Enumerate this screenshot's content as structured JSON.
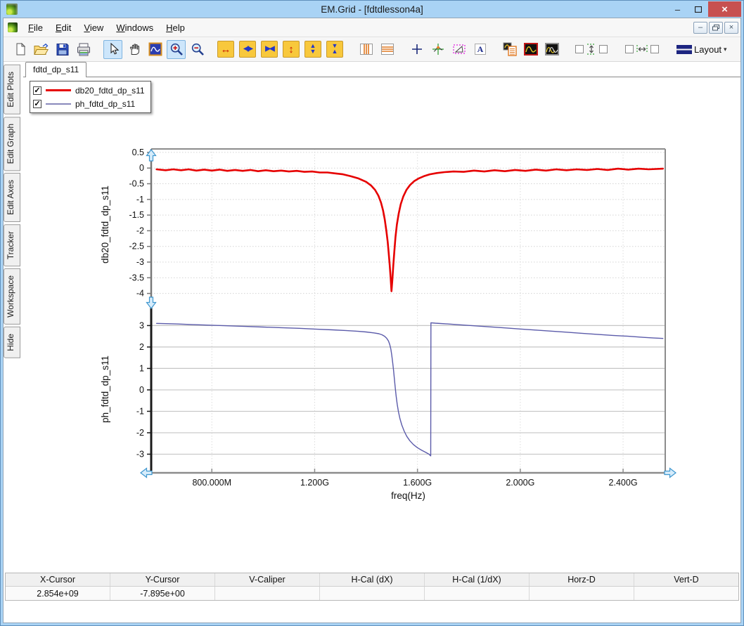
{
  "window": {
    "title": "EM.Grid - [fdtdlesson4a]"
  },
  "titlebar_icons": [
    "app-icon",
    "minimize-icon",
    "maximize-icon",
    "close-icon"
  ],
  "menu": {
    "items": [
      "File",
      "Edit",
      "View",
      "Windows",
      "Help"
    ]
  },
  "mdi_icons": [
    "mdi-minimize-icon",
    "mdi-restore-icon",
    "mdi-close-icon"
  ],
  "toolbar": {
    "layout_label": "Layout",
    "groups": [
      [
        {
          "name": "new-document"
        },
        {
          "name": "open-file"
        },
        {
          "name": "save-file"
        },
        {
          "name": "print"
        }
      ],
      [
        {
          "name": "select-pointer",
          "active": true
        },
        {
          "name": "pan-hand"
        },
        {
          "name": "zoom-window"
        },
        {
          "name": "zoom-in",
          "active": true
        },
        {
          "name": "zoom-out"
        }
      ],
      [
        {
          "name": "expand-x",
          "style": "yellow"
        },
        {
          "name": "shrink-x",
          "style": "yellow"
        },
        {
          "name": "compress-x",
          "style": "yellow"
        },
        {
          "name": "expand-y",
          "style": "yellow"
        },
        {
          "name": "shrink-y",
          "style": "yellow"
        },
        {
          "name": "compress-y",
          "style": "yellow"
        }
      ],
      [
        {
          "name": "vertical-markers"
        },
        {
          "name": "horizontal-markers"
        }
      ],
      [
        {
          "name": "crosshair"
        },
        {
          "name": "tracker"
        },
        {
          "name": "caliper"
        },
        {
          "name": "text-label"
        }
      ],
      [
        {
          "name": "copy-plot"
        },
        {
          "name": "trace-single"
        },
        {
          "name": "trace-overlay"
        }
      ],
      [
        {
          "name": "v-caliper-toggles",
          "wide": true
        }
      ],
      [
        {
          "name": "h-caliper-toggles",
          "wide": true
        }
      ],
      [
        {
          "name": "layout-menu",
          "wide": true
        }
      ]
    ]
  },
  "sidebar": {
    "tabs": [
      "Edit Plots",
      "Edit Graph",
      "Edit Axes",
      "Tracker",
      "Workspace",
      "Hide"
    ]
  },
  "document_tab": {
    "label": "fdtd_dp_s11"
  },
  "legend": {
    "items": [
      {
        "label": "db20_fdtd_dp_s11",
        "color": "#e60000",
        "thickness": 3,
        "checked": true
      },
      {
        "label": "ph_fdtd_dp_s11",
        "color": "#8888bb",
        "thickness": 2,
        "checked": true
      }
    ]
  },
  "status_bar": {
    "columns": [
      {
        "label": "X-Cursor",
        "value": "2.854e+09"
      },
      {
        "label": "Y-Cursor",
        "value": "-7.895e+00"
      },
      {
        "label": "V-Caliper",
        "value": ""
      },
      {
        "label": "H-Cal (dX)",
        "value": ""
      },
      {
        "label": "H-Cal (1/dX)",
        "value": ""
      },
      {
        "label": "Horz-D",
        "value": ""
      },
      {
        "label": "Vert-D",
        "value": ""
      }
    ]
  },
  "chart_data": {
    "type": "line",
    "x_axis": {
      "label": "freq(Hz)",
      "unit": "GHz",
      "range": [
        0.564,
        2.564
      ],
      "ticks": [
        [
          0.8,
          "800.000M"
        ],
        [
          1.2,
          "1.200G"
        ],
        [
          1.6,
          "1.600G"
        ],
        [
          2.0,
          "2.000G"
        ],
        [
          2.4,
          "2.400G"
        ]
      ],
      "grid": true
    },
    "subplots": [
      {
        "ylabel": "db20_fdtd_dp_s11",
        "ylim": [
          -4.21,
          0.61
        ],
        "yticks": [
          [
            0.5,
            "0.5"
          ],
          [
            0,
            "0"
          ],
          [
            -0.5,
            "-0.5"
          ],
          [
            -1,
            "-1"
          ],
          [
            -1.5,
            "-1.5"
          ],
          [
            -2,
            "-2"
          ],
          [
            -2.5,
            "-2.5"
          ],
          [
            -3,
            "-3"
          ],
          [
            -3.5,
            "-3.5"
          ],
          [
            -4,
            "-4"
          ]
        ],
        "grid": true,
        "series": {
          "name": "db20_fdtd_dp_s11",
          "color": "#e60000",
          "width": 2.6,
          "points": [
            [
              0.585,
              -0.04
            ],
            [
              0.62,
              -0.07
            ],
            [
              0.65,
              -0.04
            ],
            [
              0.68,
              -0.07
            ],
            [
              0.71,
              -0.04
            ],
            [
              0.74,
              -0.08
            ],
            [
              0.77,
              -0.05
            ],
            [
              0.8,
              -0.08
            ],
            [
              0.83,
              -0.05
            ],
            [
              0.86,
              -0.09
            ],
            [
              0.89,
              -0.06
            ],
            [
              0.92,
              -0.09
            ],
            [
              0.95,
              -0.06
            ],
            [
              0.98,
              -0.1
            ],
            [
              1.01,
              -0.07
            ],
            [
              1.04,
              -0.1
            ],
            [
              1.07,
              -0.08
            ],
            [
              1.1,
              -0.11
            ],
            [
              1.13,
              -0.09
            ],
            [
              1.16,
              -0.12
            ],
            [
              1.19,
              -0.11
            ],
            [
              1.22,
              -0.14
            ],
            [
              1.25,
              -0.14
            ],
            [
              1.28,
              -0.17
            ],
            [
              1.31,
              -0.2
            ],
            [
              1.34,
              -0.26
            ],
            [
              1.37,
              -0.33
            ],
            [
              1.4,
              -0.44
            ],
            [
              1.42,
              -0.56
            ],
            [
              1.435,
              -0.7
            ],
            [
              1.448,
              -0.88
            ],
            [
              1.458,
              -1.1
            ],
            [
              1.466,
              -1.35
            ],
            [
              1.473,
              -1.65
            ],
            [
              1.479,
              -2.0
            ],
            [
              1.484,
              -2.35
            ],
            [
              1.488,
              -2.7
            ],
            [
              1.492,
              -3.1
            ],
            [
              1.4955,
              -3.5
            ],
            [
              1.499,
              -3.93
            ],
            [
              1.5025,
              -3.55
            ],
            [
              1.506,
              -3.1
            ],
            [
              1.51,
              -2.65
            ],
            [
              1.5145,
              -2.2
            ],
            [
              1.52,
              -1.8
            ],
            [
              1.527,
              -1.45
            ],
            [
              1.535,
              -1.15
            ],
            [
              1.545,
              -0.9
            ],
            [
              1.557,
              -0.7
            ],
            [
              1.571,
              -0.54
            ],
            [
              1.587,
              -0.42
            ],
            [
              1.605,
              -0.33
            ],
            [
              1.625,
              -0.26
            ],
            [
              1.648,
              -0.2
            ],
            [
              1.675,
              -0.16
            ],
            [
              1.705,
              -0.13
            ],
            [
              1.74,
              -0.11
            ],
            [
              1.78,
              -0.12
            ],
            [
              1.82,
              -0.08
            ],
            [
              1.86,
              -0.11
            ],
            [
              1.9,
              -0.07
            ],
            [
              1.94,
              -0.1
            ],
            [
              1.98,
              -0.06
            ],
            [
              2.02,
              -0.09
            ],
            [
              2.06,
              -0.05
            ],
            [
              2.1,
              -0.08
            ],
            [
              2.14,
              -0.04
            ],
            [
              2.18,
              -0.07
            ],
            [
              2.22,
              -0.04
            ],
            [
              2.26,
              -0.06
            ],
            [
              2.3,
              -0.03
            ],
            [
              2.34,
              -0.06
            ],
            [
              2.38,
              -0.02
            ],
            [
              2.42,
              -0.05
            ],
            [
              2.46,
              -0.02
            ],
            [
              2.5,
              -0.04
            ],
            [
              2.555,
              -0.02
            ]
          ]
        }
      },
      {
        "ylabel": "ph_fdtd_dp_s11",
        "ylim": [
          -3.87,
          3.93
        ],
        "yticks": [
          [
            3,
            "3"
          ],
          [
            2,
            "2"
          ],
          [
            1,
            "1"
          ],
          [
            0,
            "0"
          ],
          [
            -1,
            "-1"
          ],
          [
            -2,
            "-2"
          ],
          [
            -3,
            "-3"
          ]
        ],
        "grid": true,
        "series": {
          "name": "ph_fdtd_dp_s11",
          "color": "#5b5baa",
          "width": 1.4,
          "points": [
            [
              0.585,
              3.1
            ],
            [
              0.65,
              3.08
            ],
            [
              0.72,
              3.05
            ],
            [
              0.79,
              3.02
            ],
            [
              0.86,
              2.99
            ],
            [
              0.93,
              2.96
            ],
            [
              1.0,
              2.93
            ],
            [
              1.07,
              2.9
            ],
            [
              1.14,
              2.87
            ],
            [
              1.21,
              2.83
            ],
            [
              1.27,
              2.8
            ],
            [
              1.32,
              2.77
            ],
            [
              1.36,
              2.74
            ],
            [
              1.4,
              2.7
            ],
            [
              1.43,
              2.66
            ],
            [
              1.45,
              2.62
            ],
            [
              1.462,
              2.57
            ],
            [
              1.472,
              2.5
            ],
            [
              1.48,
              2.41
            ],
            [
              1.487,
              2.28
            ],
            [
              1.492,
              2.12
            ],
            [
              1.4965,
              1.9
            ],
            [
              1.5,
              1.62
            ],
            [
              1.5035,
              1.28
            ],
            [
              1.507,
              0.9
            ],
            [
              1.51,
              0.52
            ],
            [
              1.5135,
              0.12
            ],
            [
              1.517,
              -0.28
            ],
            [
              1.521,
              -0.66
            ],
            [
              1.526,
              -1.02
            ],
            [
              1.532,
              -1.35
            ],
            [
              1.539,
              -1.64
            ],
            [
              1.548,
              -1.92
            ],
            [
              1.558,
              -2.16
            ],
            [
              1.57,
              -2.37
            ],
            [
              1.584,
              -2.55
            ],
            [
              1.6,
              -2.7
            ],
            [
              1.617,
              -2.82
            ],
            [
              1.633,
              -2.92
            ],
            [
              1.645,
              -3.0
            ],
            [
              1.6515,
              -3.08
            ],
            [
              1.6525,
              3.13
            ],
            [
              1.67,
              3.11
            ],
            [
              1.71,
              3.08
            ],
            [
              1.76,
              3.04
            ],
            [
              1.82,
              2.99
            ],
            [
              1.88,
              2.94
            ],
            [
              1.94,
              2.89
            ],
            [
              2.0,
              2.84
            ],
            [
              2.06,
              2.79
            ],
            [
              2.12,
              2.74
            ],
            [
              2.18,
              2.69
            ],
            [
              2.24,
              2.64
            ],
            [
              2.3,
              2.59
            ],
            [
              2.36,
              2.54
            ],
            [
              2.42,
              2.5
            ],
            [
              2.48,
              2.45
            ],
            [
              2.52,
              2.42
            ],
            [
              2.555,
              2.4
            ]
          ]
        }
      }
    ]
  }
}
